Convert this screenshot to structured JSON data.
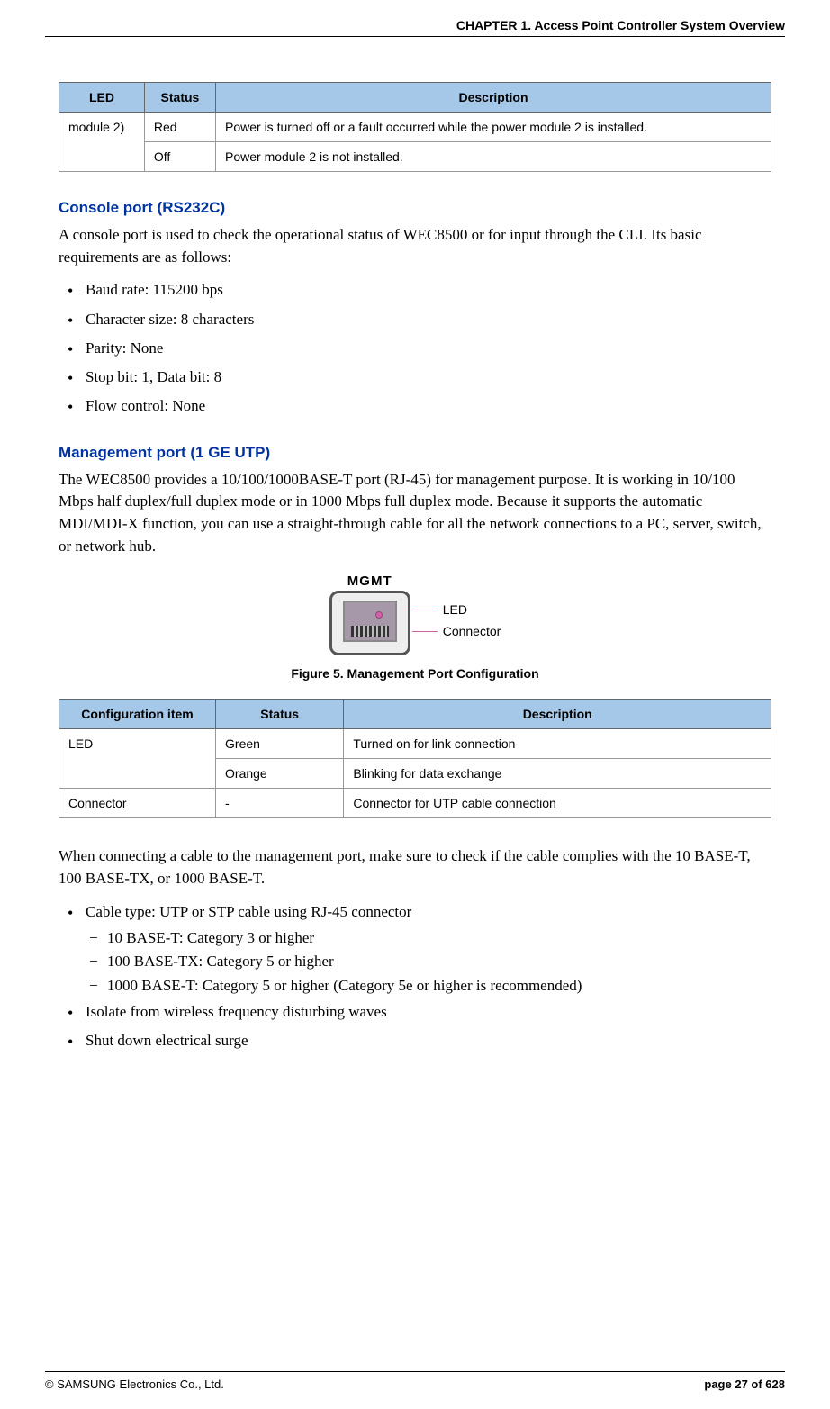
{
  "header": {
    "chapter": "CHAPTER 1. Access Point Controller System Overview"
  },
  "table1": {
    "headers": [
      "LED",
      "Status",
      "Description"
    ],
    "rows": [
      {
        "led": "module 2)",
        "status": "Red",
        "desc": "Power is turned off or a fault occurred while the power module 2 is installed."
      },
      {
        "led": "",
        "status": "Off",
        "desc": "Power module 2 is not installed."
      }
    ]
  },
  "section_console": {
    "heading": "Console port (RS232C)",
    "intro": "A console port is used to check the operational status of WEC8500 or for input through the CLI. Its basic requirements are as follows:",
    "items": [
      "Baud rate: 115200 bps",
      "Character size: 8 characters",
      "Parity: None",
      "Stop bit: 1, Data bit: 8",
      "Flow control: None"
    ]
  },
  "section_mgmt": {
    "heading": "Management port (1 GE UTP)",
    "intro": "The WEC8500 provides a 10/100/1000BASE-T port (RJ-45) for management purpose. It is working in 10/100 Mbps half duplex/full duplex mode or in 1000 Mbps full duplex mode. Because it supports the automatic MDI/MDI-X function, you can use a straight-through cable for all the network connections to a PC, server, switch, or network hub."
  },
  "figure5": {
    "port_label": "MGMT",
    "callout_led": "LED",
    "callout_connector": "Connector",
    "caption": "Figure 5. Management Port Configuration"
  },
  "table2": {
    "headers": [
      "Configuration item",
      "Status",
      "Description"
    ],
    "rows": [
      {
        "item": "LED",
        "status": "Green",
        "desc": "Turned on for link connection"
      },
      {
        "item": "",
        "status": "Orange",
        "desc": "Blinking for data exchange"
      },
      {
        "item": "Connector",
        "status": "-",
        "desc": "Connector for UTP cable connection"
      }
    ]
  },
  "cable_note": "When connecting a cable to the management port, make sure to check if the cable complies with the 10 BASE-T, 100 BASE-TX, or 1000 BASE-T.",
  "cable_bullets": [
    {
      "text": "Cable type: UTP or STP cable using RJ-45 connector",
      "sub": [
        "10 BASE-T: Category 3 or higher",
        "100 BASE-TX: Category 5 or higher",
        "1000 BASE-T: Category 5 or higher (Category 5e or higher is recommended)"
      ]
    },
    {
      "text": "Isolate from wireless frequency disturbing waves",
      "sub": []
    },
    {
      "text": "Shut down electrical surge",
      "sub": []
    }
  ],
  "footer": {
    "copyright": "© SAMSUNG Electronics Co., Ltd.",
    "page": "page 27 of 628"
  }
}
